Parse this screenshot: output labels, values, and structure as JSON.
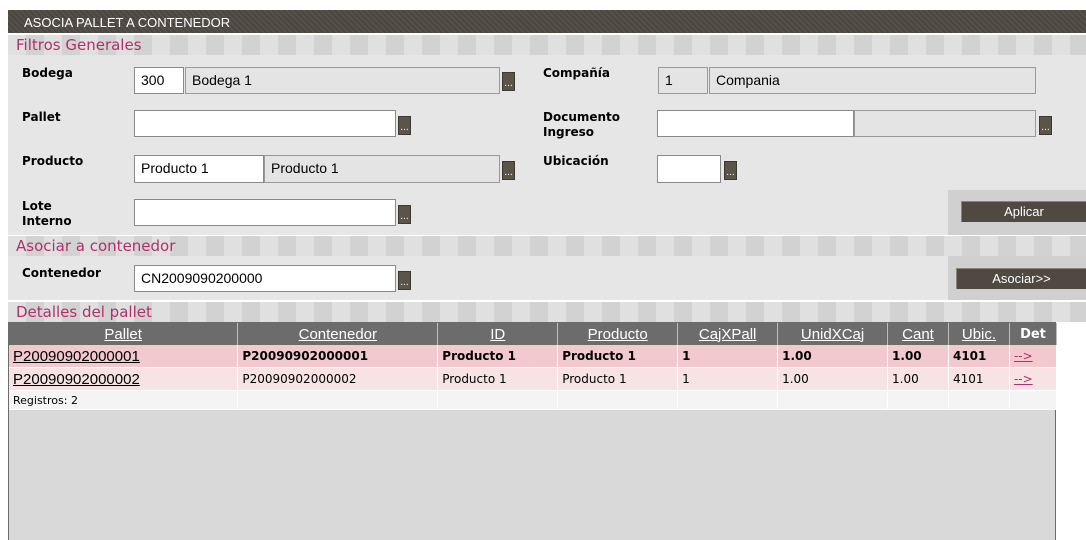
{
  "title": "ASOCIA PALLET A CONTENEDOR",
  "sections": {
    "filters": "Filtros Generales",
    "associate": "Asociar a contenedor",
    "details": "Detalles del pallet"
  },
  "filters": {
    "bodega_label": "Bodega",
    "bodega_code": "300",
    "bodega_name": "Bodega 1",
    "compania_label": "Compañía",
    "compania_code": "1",
    "compania_name": "Compania",
    "pallet_label": "Pallet",
    "pallet_value": "",
    "documento_label_1": "Documento",
    "documento_label_2": "Ingreso",
    "documento_value": "",
    "documento_desc": "",
    "producto_label": "Producto",
    "producto_code": "Producto 1",
    "producto_name": "Producto 1",
    "ubicacion_label": "Ubicación",
    "ubicacion_value": "",
    "lote_label_1": "Lote",
    "lote_label_2": "Interno",
    "lote_value": "",
    "aplicar": "Aplicar",
    "ellipsis": "..."
  },
  "associate": {
    "contenedor_label": "Contenedor",
    "contenedor_value": "CN2009090200000",
    "asociar": "Asociar>>"
  },
  "grid": {
    "columns": [
      "Pallet",
      "Contenedor",
      "ID",
      "Producto",
      "CajXPall",
      "UnidXCaj",
      "Cant",
      "Ubic.",
      "Det"
    ],
    "rows": [
      {
        "pallet": "P20090902000001",
        "contenedor": "P20090902000001",
        "id": "Producto 1",
        "producto": "Producto 1",
        "cajxpall": "1",
        "unidxcaj": "1.00",
        "cant": "1.00",
        "ubic": "4101",
        "det": "-->"
      },
      {
        "pallet": "P20090902000002",
        "contenedor": "P20090902000002",
        "id": "Producto 1",
        "producto": "Producto 1",
        "cajxpall": "1",
        "unidxcaj": "1.00",
        "cant": "1.00",
        "ubic": "4101",
        "det": "-->"
      }
    ],
    "footer": "Registros: 2"
  }
}
